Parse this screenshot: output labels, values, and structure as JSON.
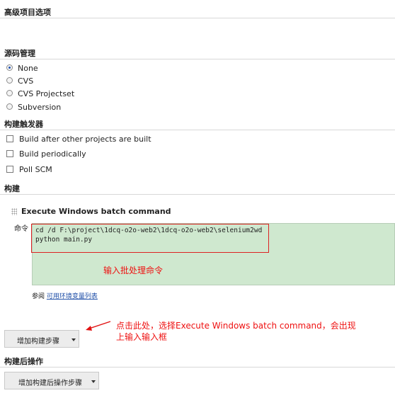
{
  "sections": {
    "advanced": "高级项目选项",
    "scm": "源码管理",
    "triggers": "构建触发器",
    "build": "构建",
    "post_build": "构建后操作"
  },
  "scm_options": [
    {
      "label": "None",
      "checked": true
    },
    {
      "label": "CVS",
      "checked": false
    },
    {
      "label": "CVS Projectset",
      "checked": false
    },
    {
      "label": "Subversion",
      "checked": false
    }
  ],
  "trigger_options": [
    {
      "label": "Build after other projects are built",
      "checked": false
    },
    {
      "label": "Build periodically",
      "checked": false
    },
    {
      "label": "Poll SCM",
      "checked": false
    }
  ],
  "build_step": {
    "title": "Execute Windows batch command",
    "command_label": "命令",
    "command_lines": [
      "cd /d F:\\project\\1dcq-o2o-web2\\1dcq-o2o-web2\\selenium2wd",
      "python main.py"
    ],
    "env_ref_prefix": "参阅",
    "env_ref_link": "可用环境变量列表"
  },
  "annotations": {
    "input_hint": "输入批处理命令",
    "click_hint_line1": "点击此处，选择Execute Windows batch command，会出现",
    "click_hint_line2": "上输入输入框",
    "color": "#e11111"
  },
  "buttons": {
    "add_build_step": "增加构建步骤",
    "add_post_build_step": "增加构建后操作步骤"
  }
}
